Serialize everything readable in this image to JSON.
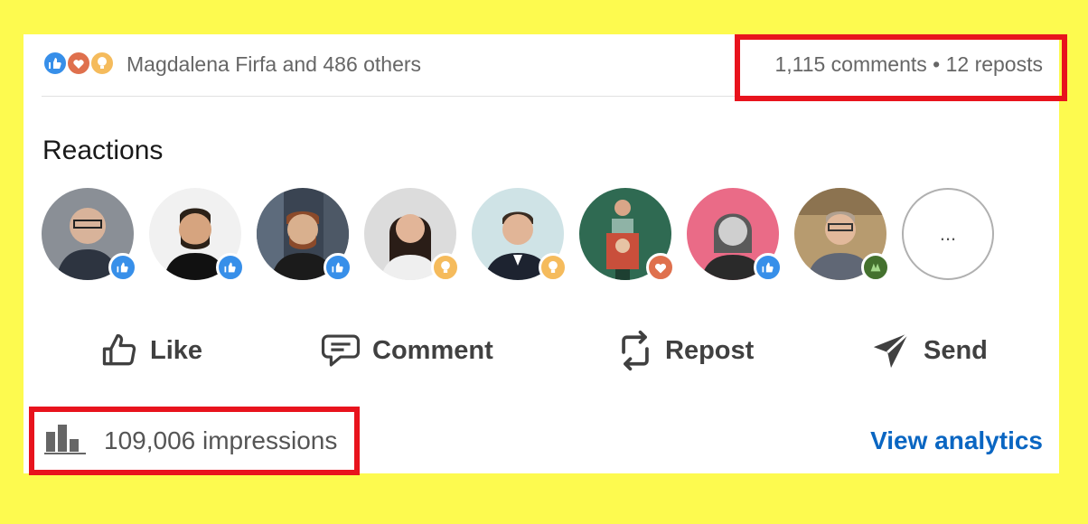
{
  "social": {
    "names": "Magdalena Firfa and 486 others",
    "counts": "1,115 comments • 12 reposts"
  },
  "reactions": {
    "title": "Reactions",
    "avatars": [
      {
        "reaction": "like"
      },
      {
        "reaction": "like"
      },
      {
        "reaction": "like"
      },
      {
        "reaction": "insightful"
      },
      {
        "reaction": "insightful"
      },
      {
        "reaction": "love"
      },
      {
        "reaction": "like"
      },
      {
        "reaction": "celebrate"
      }
    ],
    "more_label": "..."
  },
  "actions": {
    "like": "Like",
    "comment": "Comment",
    "repost": "Repost",
    "send": "Send"
  },
  "footer": {
    "impressions": "109,006 impressions",
    "analytics": "View analytics"
  },
  "colors": {
    "background": "#fdfa4f",
    "highlight": "#e8131d",
    "link": "#0a66c2",
    "like": "#378fe9",
    "love": "#df704d",
    "insightful": "#f5bb5c",
    "celebrate": "#44712e"
  }
}
